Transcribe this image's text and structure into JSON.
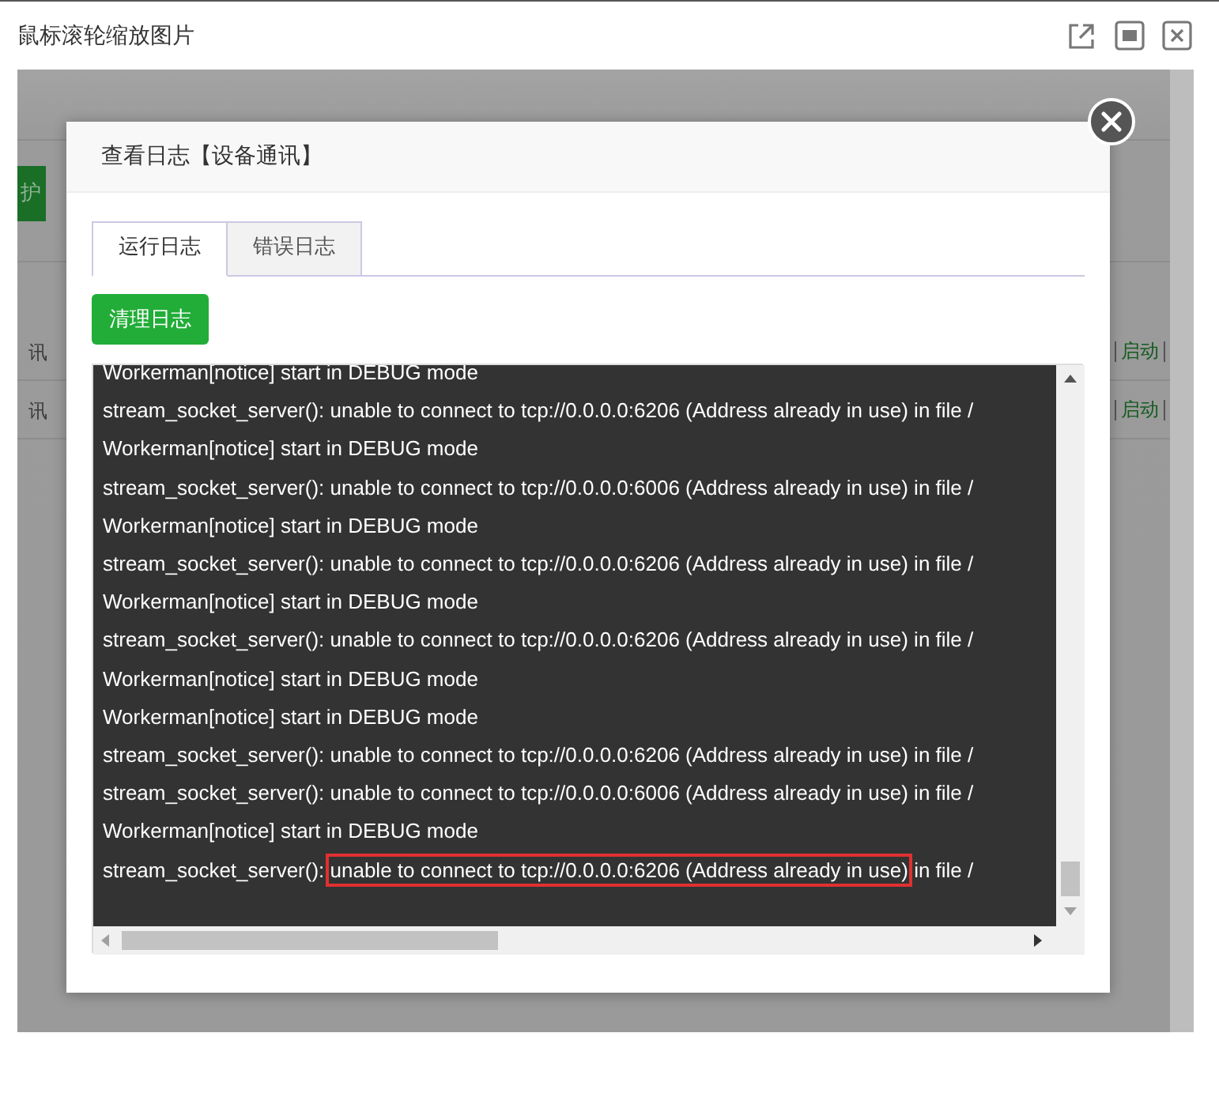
{
  "window": {
    "title": "鼠标滚轮缩放图片"
  },
  "background_page": {
    "button": "护",
    "rows": [
      {
        "label": "讯",
        "action": "启动"
      },
      {
        "label": "讯",
        "action": "启动"
      }
    ]
  },
  "dialog": {
    "title": "查看日志【设备通讯】",
    "tabs": [
      {
        "label": "运行日志",
        "selected": true
      },
      {
        "label": "错误日志",
        "selected": false
      }
    ],
    "clear_button": "清理日志",
    "log_lines": [
      {
        "text": "Workerman[notice] start in DEBUG mode"
      },
      {
        "text": "stream_socket_server(): unable to connect to tcp://0.0.0.0:6206 (Address already in use) in file /"
      },
      {
        "text": "Workerman[notice] start in DEBUG mode"
      },
      {
        "text": "stream_socket_server(): unable to connect to tcp://0.0.0.0:6006 (Address already in use) in file /"
      },
      {
        "text": "Workerman[notice] start in DEBUG mode"
      },
      {
        "text": "stream_socket_server(): unable to connect to tcp://0.0.0.0:6206 (Address already in use) in file /"
      },
      {
        "text": "Workerman[notice] start in DEBUG mode"
      },
      {
        "text": "stream_socket_server(): unable to connect to tcp://0.0.0.0:6206 (Address already in use) in file /"
      },
      {
        "text": "Workerman[notice] start in DEBUG mode"
      },
      {
        "text": "Workerman[notice] start in DEBUG mode"
      },
      {
        "text": "stream_socket_server(): unable to connect to tcp://0.0.0.0:6206 (Address already in use) in file /"
      },
      {
        "text": "stream_socket_server(): unable to connect to tcp://0.0.0.0:6006 (Address already in use) in file /"
      },
      {
        "text": "Workerman[notice] start in DEBUG mode"
      },
      {
        "text": "stream_socket_server(): ",
        "boxed": "unable to connect to tcp://0.0.0.0:6206 (Address already in use)",
        "after": " in file /"
      }
    ]
  }
}
